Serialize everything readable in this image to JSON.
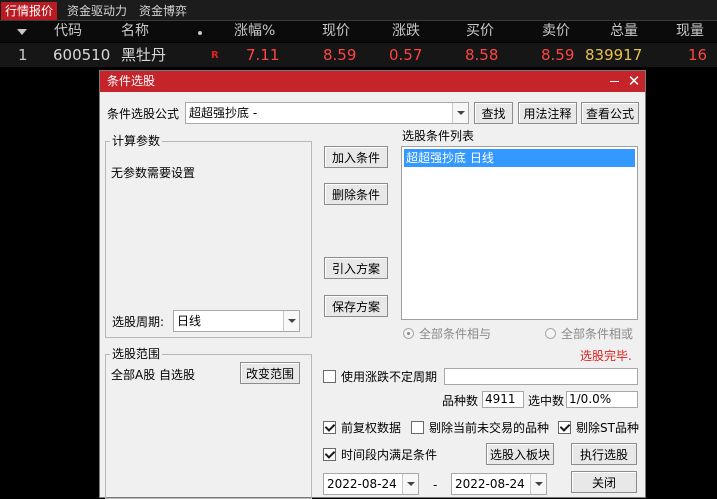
{
  "tabbar": {
    "tabs": [
      {
        "label": "行情报价",
        "active": true
      },
      {
        "label": "资金驱动力",
        "active": false
      },
      {
        "label": "资金博弈",
        "active": false
      }
    ]
  },
  "quote_table": {
    "columns": [
      "代码",
      "名称",
      "涨幅%",
      "现价",
      "涨跌",
      "买价",
      "卖价",
      "总量",
      "现量"
    ],
    "row": {
      "index": "1",
      "code": "600510",
      "name": "黑牡丹",
      "flag": "R",
      "change_pct": "7.11",
      "price": "8.59",
      "change": "0.57",
      "bid": "8.58",
      "ask": "8.59",
      "volume": "839917",
      "last_volume": "16"
    },
    "colors": {
      "up": "#ff4444",
      "volume": "#e8c14a",
      "header_text": "#c8c8c8"
    }
  },
  "dialog": {
    "title": "条件选股",
    "formula_label": "条件选股公式",
    "formula_value": "超超强抄底  -",
    "find_button": "查找",
    "usage_button": "用法注释",
    "view_button": "查看公式",
    "params_group_title": "计算参数",
    "params_text": "无参数需要设置",
    "period_label": "选股周期:",
    "period_value": "日线",
    "add_button": "加入条件",
    "delete_button": "删除条件",
    "import_button": "引入方案",
    "save_button": "保存方案",
    "list_title": "选股条件列表",
    "list_items": [
      "超超强抄底  日线"
    ],
    "radio_and": "全部条件相与",
    "radio_or": "全部条件相或",
    "status_text": "选股完毕.",
    "range_group_title": "选股范围",
    "range_text": "全部A股 自选股",
    "change_range_button": "改变范围",
    "use_period_label": "使用涨跌不定周期",
    "count_label": "品种数",
    "count_value": "4911",
    "selected_label": "选中数",
    "selected_value": "1/0.0%",
    "adjust_label": "前复权数据",
    "exclude_untraded_label": "剔除当前未交易的品种",
    "exclude_st_label": "剔除ST品种",
    "time_range_label": "时间段内满足条件",
    "to_block_button": "选股入板块",
    "execute_button": "执行选股",
    "start_date": "2022-08-24",
    "date_separator": "-",
    "end_date": "2022-08-24",
    "close_button": "关闭",
    "checks": {
      "use_period": false,
      "adjust": true,
      "exclude_untraded": false,
      "exclude_st": true,
      "time_range": true
    },
    "colors": {
      "titlebar": "#c4242a",
      "status": "#e02020",
      "selection": "#3399ff"
    }
  }
}
